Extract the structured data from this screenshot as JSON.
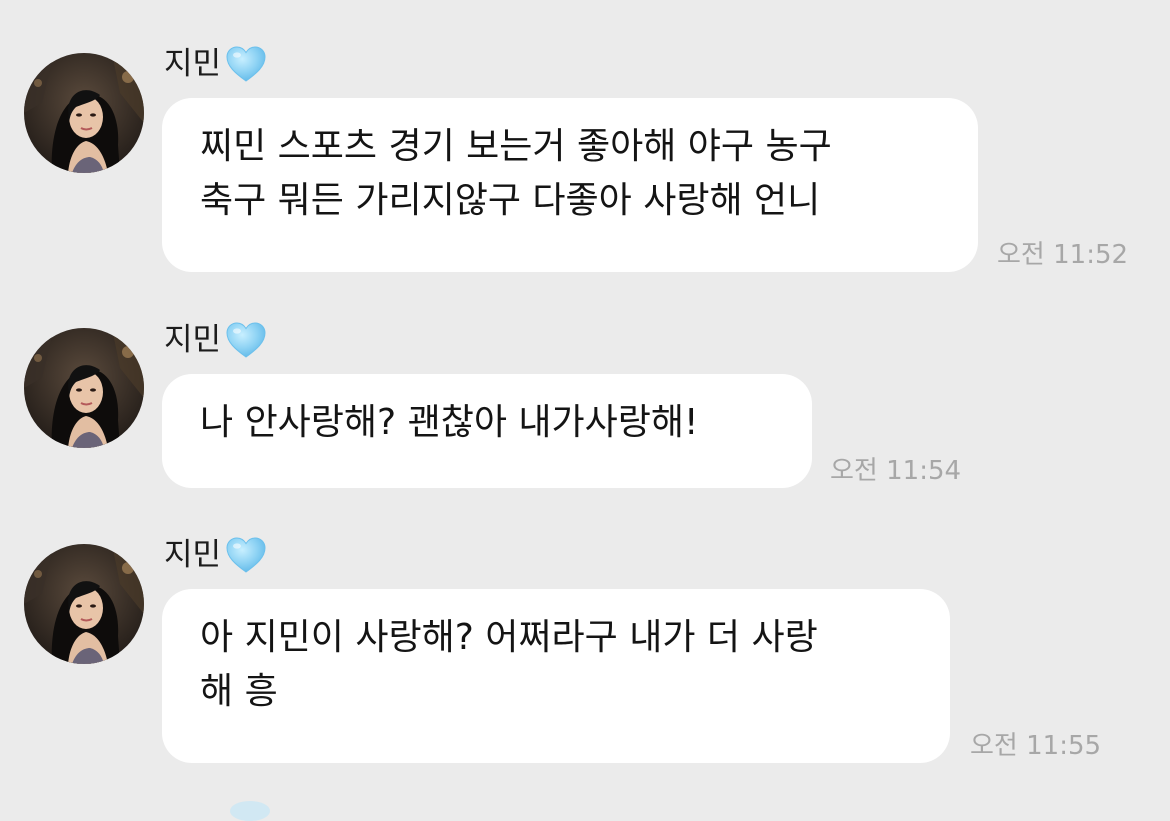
{
  "messages": [
    {
      "sender": "지민",
      "text": "찌민 스포츠 경기 보는거 좋아해 야구 농구\n축구 뭐든 가리지않구 다좋아 사랑해 언니",
      "time": "오전 11:52"
    },
    {
      "sender": "지민",
      "text": "나 안사랑해? 괜찮아 내가사랑해!",
      "time": "오전 11:54"
    },
    {
      "sender": "지민",
      "text": "아 지민이 사랑해? 어쩌라구 내가 더 사랑\n해 흥",
      "time": "오전 11:55"
    }
  ],
  "colors": {
    "background": "#ebebeb",
    "bubble": "#ffffff",
    "heart": "#8fd3f4",
    "timestamp": "#a7a7a7"
  },
  "icons": {
    "sender_badge": "light-blue-heart-icon",
    "avatar": "profile-photo"
  }
}
